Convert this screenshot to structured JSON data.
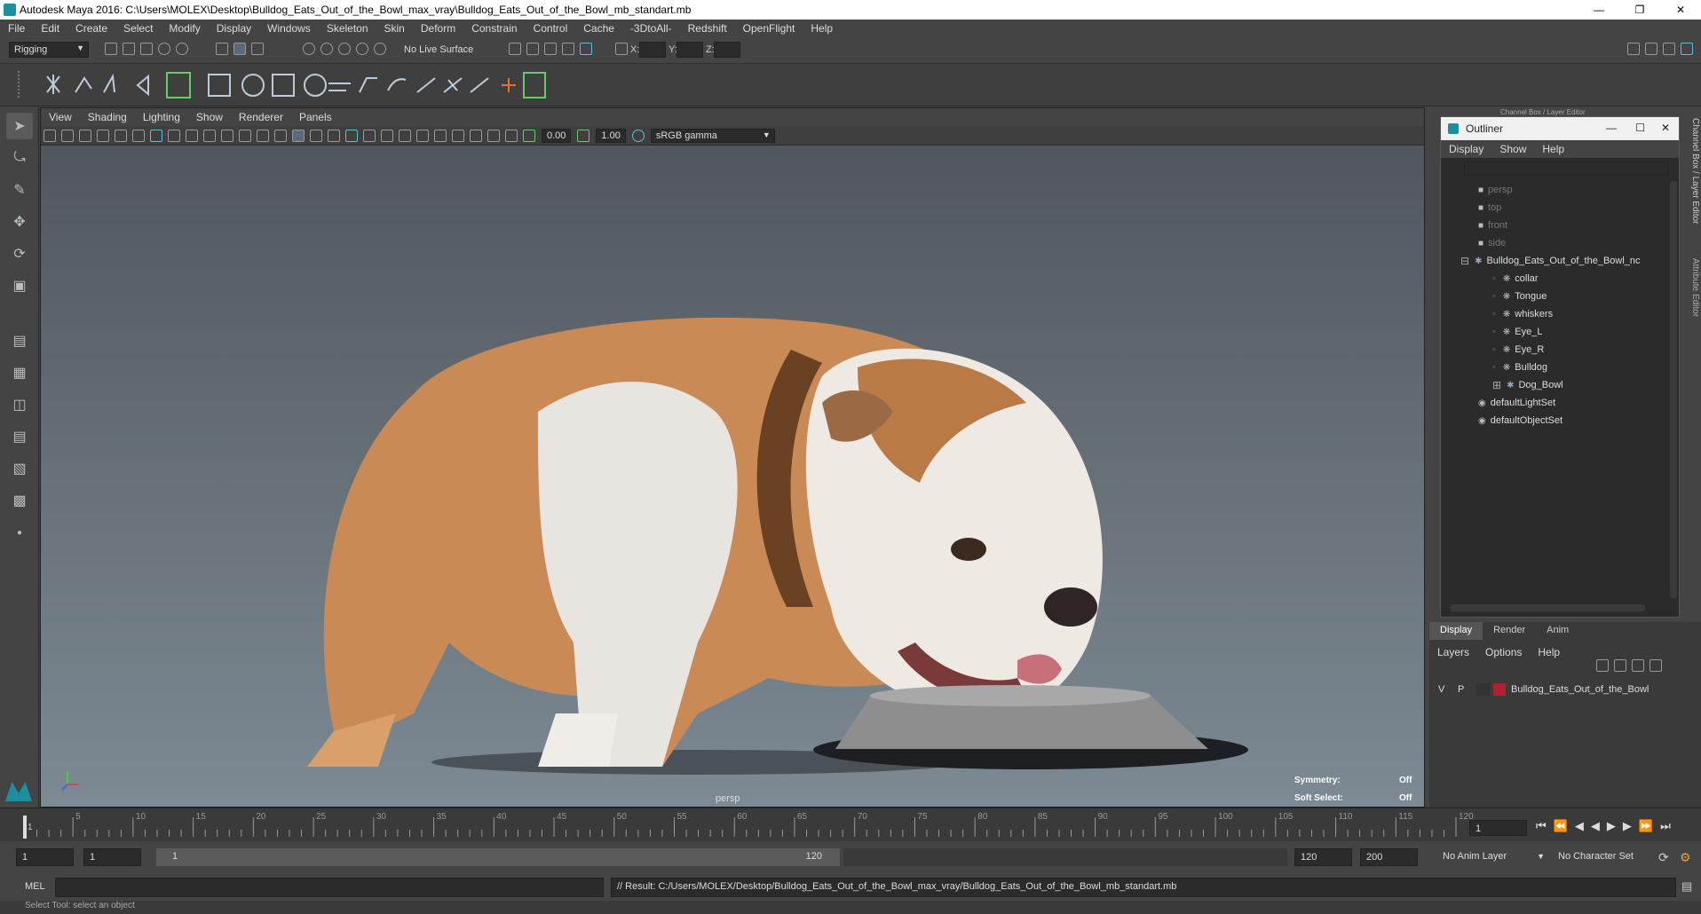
{
  "window": {
    "title": "Autodesk Maya 2016: C:\\Users\\MOLEX\\Desktop\\Bulldog_Eats_Out_of_the_Bowl_max_vray\\Bulldog_Eats_Out_of_the_Bowl_mb_standart.mb"
  },
  "menubar": [
    "File",
    "Edit",
    "Create",
    "Select",
    "Modify",
    "Display",
    "Windows",
    "Skeleton",
    "Skin",
    "Deform",
    "Constrain",
    "Control",
    "Cache",
    "-3DtoAll-",
    "Redshift",
    "OpenFlight",
    "Help"
  ],
  "statusline": {
    "menu_set": "Rigging",
    "live_surface": "No Live Surface",
    "x_label": "X:",
    "y_label": "Y:",
    "z_label": "Z:"
  },
  "viewport": {
    "menu": [
      "View",
      "Shading",
      "Lighting",
      "Show",
      "Renderer",
      "Panels"
    ],
    "near_value": "0.00",
    "far_value": "1.00",
    "color_space": "sRGB gamma",
    "camera_label": "persp",
    "symmetry_label": "Symmetry:",
    "symmetry_value": "Off",
    "soft_select_label": "Soft Select:",
    "soft_select_value": "Off"
  },
  "right_panel": {
    "header": "Channel Box / Layer Editor",
    "side_tabs": [
      "Channel Box / Layer Editor",
      "Attribute Editor"
    ]
  },
  "outliner": {
    "title": "Outliner",
    "menu": [
      "Display",
      "Show",
      "Help"
    ],
    "items": [
      {
        "label": "persp",
        "indent": 0,
        "kind": "camera",
        "dim": true
      },
      {
        "label": "top",
        "indent": 0,
        "kind": "camera",
        "dim": true
      },
      {
        "label": "front",
        "indent": 0,
        "kind": "camera",
        "dim": true
      },
      {
        "label": "side",
        "indent": 0,
        "kind": "camera",
        "dim": true
      },
      {
        "label": "Bulldog_Eats_Out_of_the_Bowl_nc",
        "indent": 0,
        "kind": "group",
        "dim": false
      },
      {
        "label": "collar",
        "indent": 1,
        "kind": "mesh",
        "dim": false
      },
      {
        "label": "Tongue",
        "indent": 1,
        "kind": "mesh",
        "dim": false
      },
      {
        "label": "whiskers",
        "indent": 1,
        "kind": "mesh",
        "dim": false
      },
      {
        "label": "Eye_L",
        "indent": 1,
        "kind": "mesh",
        "dim": false
      },
      {
        "label": "Eye_R",
        "indent": 1,
        "kind": "mesh",
        "dim": false
      },
      {
        "label": "Bulldog",
        "indent": 1,
        "kind": "mesh",
        "dim": false
      },
      {
        "label": "Dog_Bowl",
        "indent": 1,
        "kind": "group",
        "dim": false
      },
      {
        "label": "defaultLightSet",
        "indent": 0,
        "kind": "set",
        "dim": false
      },
      {
        "label": "defaultObjectSet",
        "indent": 0,
        "kind": "set",
        "dim": false
      }
    ]
  },
  "layer_editor": {
    "tabs": [
      "Display",
      "Render",
      "Anim"
    ],
    "menu": [
      "Layers",
      "Options",
      "Help"
    ],
    "layer": {
      "v": "V",
      "p": "P",
      "name": "Bulldog_Eats_Out_of_the_Bowl",
      "color": "#b0202e"
    }
  },
  "timeline": {
    "ticks": [
      "5",
      "10",
      "15",
      "20",
      "25",
      "30",
      "35",
      "40",
      "45",
      "50",
      "55",
      "60",
      "65",
      "70",
      "75",
      "80",
      "85",
      "90",
      "95",
      "100",
      "105",
      "110",
      "115",
      "120"
    ],
    "first_tick": "1",
    "current_frame": "1"
  },
  "range": {
    "start": "1",
    "playback_start": "1",
    "slider_start": "1",
    "slider_end": "120",
    "playback_end": "120",
    "end": "200",
    "anim_layer": "No Anim Layer",
    "character_set": "No Character Set"
  },
  "cmdline": {
    "language": "MEL",
    "result": "// Result: C:/Users/MOLEX/Desktop/Bulldog_Eats_Out_of_the_Bowl_max_vray/Bulldog_Eats_Out_of_the_Bowl_mb_standart.mb"
  },
  "helpline": "Select Tool: select an object",
  "colors": {
    "viewport_top": "#4e5459",
    "viewport_bottom": "#7d8a93",
    "accent": "#5bc0de"
  }
}
